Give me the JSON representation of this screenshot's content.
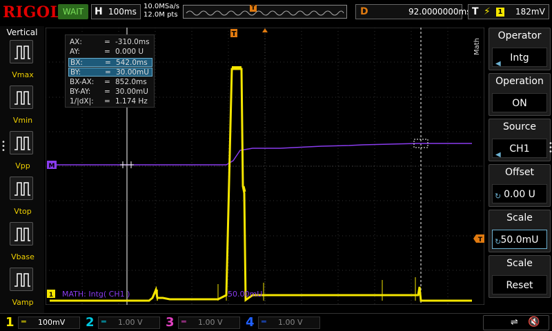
{
  "header": {
    "logo": "RIGOL",
    "run_status": "WAIT",
    "timebase_label": "H",
    "timebase_value": "100ms",
    "sample_rate": "10.0MSa/s",
    "memory_depth": "12.0M pts",
    "memory_marker": "T",
    "delay_label": "D",
    "delay_value": "92.0000000ms",
    "trigger_label": "T",
    "trigger_channel": "1",
    "trigger_level": "182mV"
  },
  "left_panel": {
    "title": "Vertical",
    "items": [
      {
        "label": "Vmax"
      },
      {
        "label": "Vmin"
      },
      {
        "label": "Vpp"
      },
      {
        "label": "Vtop"
      },
      {
        "label": "Vbase"
      },
      {
        "label": "Vamp"
      }
    ]
  },
  "cursors": [
    {
      "key": "AX:",
      "eq": "=",
      "value": "-310.0ms",
      "selected": false
    },
    {
      "key": "AY:",
      "eq": "=",
      "value": "0.000 U",
      "selected": false
    },
    {
      "key": "BX:",
      "eq": "=",
      "value": "542.0ms",
      "selected": true
    },
    {
      "key": "BY:",
      "eq": "=",
      "value": "30.00mU",
      "selected": true
    },
    {
      "key": "BX-AX:",
      "eq": "=",
      "value": "852.0ms",
      "selected": false
    },
    {
      "key": "BY-AY:",
      "eq": "=",
      "value": "30.00mU",
      "selected": false
    },
    {
      "key": "1/|dX|:",
      "eq": "=",
      "value": "1.174 Hz",
      "selected": false
    }
  ],
  "screen": {
    "math_label": "MATH: Intg( CH1 )",
    "math_scale": "50.00mU",
    "trigger_marker": "T",
    "math_marker": "M",
    "ch1_marker": "1"
  },
  "right_panel": {
    "side_label": "Math",
    "buttons": [
      {
        "title": "Operator",
        "value": "Intg"
      },
      {
        "title": "Operation",
        "value": "ON"
      },
      {
        "title": "Source",
        "value": "CH1"
      },
      {
        "title": "Offset",
        "value": "0.00 U"
      },
      {
        "title": "Scale",
        "value": "50.0mU"
      },
      {
        "title": "Scale",
        "value": "Reset"
      }
    ]
  },
  "channels": [
    {
      "num": "1",
      "coupling": "═",
      "scale": "100mV",
      "color": "#f5e600"
    },
    {
      "num": "2",
      "coupling": "═",
      "scale": "1.00 V",
      "color": "#00c8e0"
    },
    {
      "num": "3",
      "coupling": "═",
      "scale": "1.00 V",
      "color": "#e040c0"
    },
    {
      "num": "4",
      "coupling": "═",
      "scale": "1.00 V",
      "color": "#2060ff"
    }
  ],
  "colors": {
    "ch1": "#f5e600",
    "math": "#8a3cf0",
    "accent": "#6cb0d0",
    "trigger": "#e07a10"
  }
}
